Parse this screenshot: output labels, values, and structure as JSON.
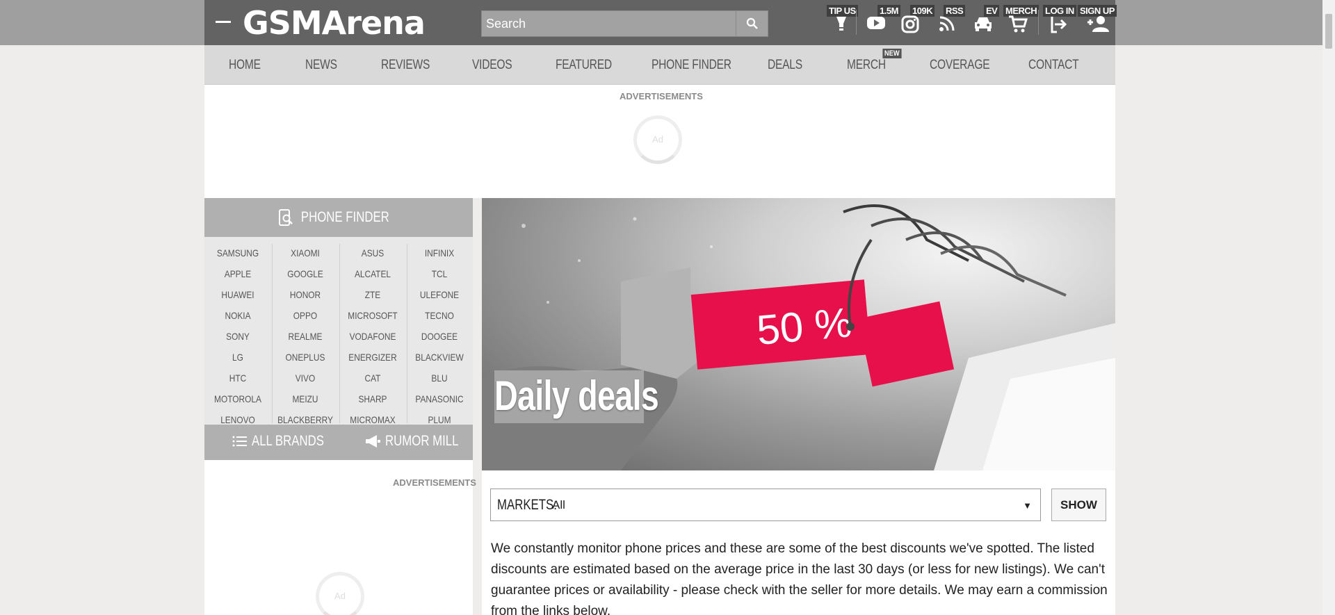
{
  "header": {
    "logo": "GSMArena",
    "search_placeholder": "Search",
    "icons": [
      {
        "name": "tip-us",
        "label": "TIP US",
        "icon": "lightbulb-icon"
      },
      {
        "name": "youtube",
        "label": "1.5M",
        "icon": "youtube-icon"
      },
      {
        "name": "instagram",
        "label": "109K",
        "icon": "instagram-icon"
      },
      {
        "name": "rss",
        "label": "RSS",
        "icon": "rss-icon"
      },
      {
        "name": "ev",
        "label": "EV",
        "icon": "car-icon"
      },
      {
        "name": "merch",
        "label": "MERCH",
        "icon": "cart-icon"
      },
      {
        "name": "log-in",
        "label": "LOG IN",
        "icon": "login-icon"
      },
      {
        "name": "sign-up",
        "label": "SIGN UP",
        "icon": "add-user-icon"
      }
    ]
  },
  "nav": {
    "items": [
      "HOME",
      "NEWS",
      "REVIEWS",
      "VIDEOS",
      "FEATURED",
      "PHONE FINDER",
      "DEALS",
      "MERCH",
      "COVERAGE",
      "CONTACT"
    ],
    "new_badge": "NEW"
  },
  "ads": {
    "label": "ADVERTISEMENTS",
    "placeholder": "Ad"
  },
  "phone_finder": {
    "title": "PHONE FINDER",
    "columns": [
      [
        "SAMSUNG",
        "APPLE",
        "HUAWEI",
        "NOKIA",
        "SONY",
        "LG",
        "HTC",
        "MOTOROLA",
        "LENOVO"
      ],
      [
        "XIAOMI",
        "GOOGLE",
        "HONOR",
        "OPPO",
        "REALME",
        "ONEPLUS",
        "VIVO",
        "MEIZU",
        "BLACKBERRY"
      ],
      [
        "ASUS",
        "ALCATEL",
        "ZTE",
        "MICROSOFT",
        "VODAFONE",
        "ENERGIZER",
        "CAT",
        "SHARP",
        "MICROMAX"
      ],
      [
        "INFINIX",
        "TCL",
        "ULEFONE",
        "TECNO",
        "DOOGEE",
        "BLACKVIEW",
        "BLU",
        "PANASONIC",
        "PLUM"
      ]
    ],
    "all_brands": "ALL BRANDS",
    "rumor_mill": "RUMOR MILL"
  },
  "main": {
    "hero_title": "Daily deals",
    "hero_tag_text": "50 %",
    "markets_label": "MARKETS:",
    "markets_value": "All",
    "show_button": "SHOW",
    "intro": "We constantly monitor phone prices and these are some of the best discounts we've spotted. The listed discounts are estimated based on the average price in the last 30 days (or less for new listings). We can't guarantee prices or availability - please check with the seller for more details. We may earn a commission from the links below."
  },
  "colors": {
    "header_bg": "#636363",
    "nav_bg": "#d9d9d9",
    "sidebar_head_bg": "#b0b0b0",
    "tag_red": "#e8104a"
  }
}
